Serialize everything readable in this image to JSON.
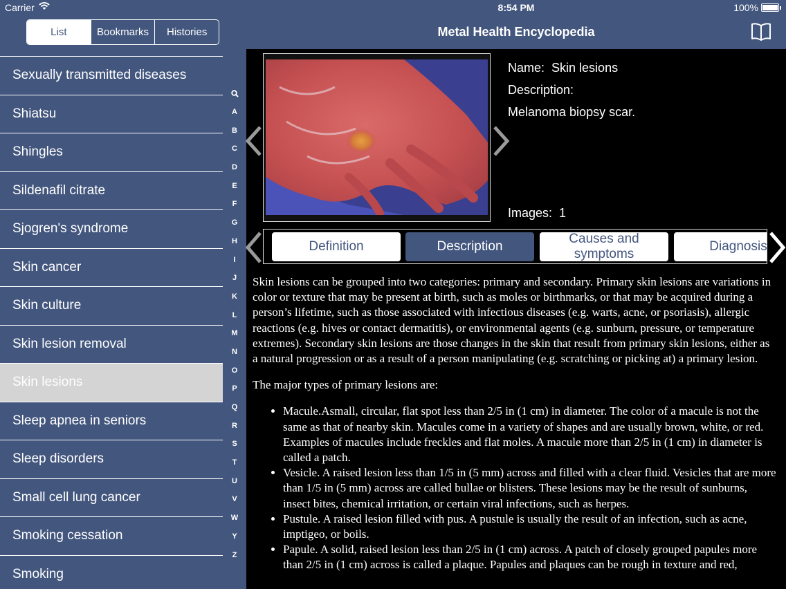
{
  "status": {
    "carrier": "Carrier",
    "time": "8:54 PM",
    "battery": "100%"
  },
  "segments": [
    "List",
    "Bookmarks",
    "Histories"
  ],
  "list": {
    "items": [
      "Sexually transmitted diseases",
      "Shiatsu",
      "Shingles",
      "Sildenafil citrate",
      "Sjogren's syndrome",
      "Skin cancer",
      "Skin culture",
      "Skin lesion removal",
      "Skin lesions",
      "Sleep apnea in seniors",
      "Sleep disorders",
      "Small cell lung cancer",
      "Smoking cessation",
      "Smoking"
    ],
    "selected_label": "Skin lesions"
  },
  "index": [
    "A",
    "B",
    "C",
    "D",
    "E",
    "F",
    "G",
    "H",
    "I",
    "J",
    "K",
    "L",
    "M",
    "N",
    "O",
    "P",
    "Q",
    "R",
    "S",
    "T",
    "U",
    "V",
    "W",
    "Y",
    "Z"
  ],
  "nav": {
    "title": "Metal Health Encyclopedia",
    "icon": "book-icon"
  },
  "entry": {
    "name_label": "Name:",
    "name_value": "Skin lesions",
    "description_label": "Description:",
    "description_value": "Melanoma biopsy scar.",
    "images_label": "Images:",
    "images_value": "1"
  },
  "tabs": [
    {
      "label": "Definition",
      "active": false
    },
    {
      "label": "Description",
      "active": true
    },
    {
      "label": "Causes and symptoms",
      "active": false
    },
    {
      "label": "Diagnosis",
      "active": false
    }
  ],
  "content": {
    "para1": "Skin lesions can be grouped into two categories: primary and secondary. Primary skin lesions are variations in color or texture that may be present at birth, such as moles or birthmarks, or that may be acquired during a person’s lifetime, such as those associated with infectious diseases (e.g. warts, acne, or psoriasis), allergic reactions (e.g. hives or contact dermatitis), or environmental agents (e.g. sunburn, pressure, or temperature extremes). Secondary skin lesions are those changes in the skin that result from primary skin lesions, either as a natural progression or as a result of a person manipulating (e.g. scratching or picking at) a primary lesion.",
    "para2": "The major types of primary lesions are:",
    "bullets": [
      "Macule.Asmall, circular, flat spot less than 2/5 in (1 cm) in diameter. The color of a macule is not the same as that of nearby skin. Macules come in a variety of shapes and are usually brown, white, or red. Examples of macules include freckles and flat moles. A macule more than 2/5 in (1 cm) in diameter is called a patch.",
      "Vesicle. A raised lesion less than 1/5 in (5 mm) across and filled with a clear fluid. Vesicles that are more than 1/5 in (5 mm) across are called bullae or blisters. These lesions may be the result of sunburns, insect bites, chemical irritation, or certain viral infections, such as herpes.",
      "Pustule. A raised lesion filled with pus. A pustule is usually the result of an infection, such as acne, imptigeo, or boils.",
      "Papule. A solid, raised lesion less than 2/5 in (1 cm) across. A patch of closely grouped papules more than 2/5 in (1 cm) across is called a plaque. Papules and plaques can be rough in texture and red,"
    ]
  }
}
